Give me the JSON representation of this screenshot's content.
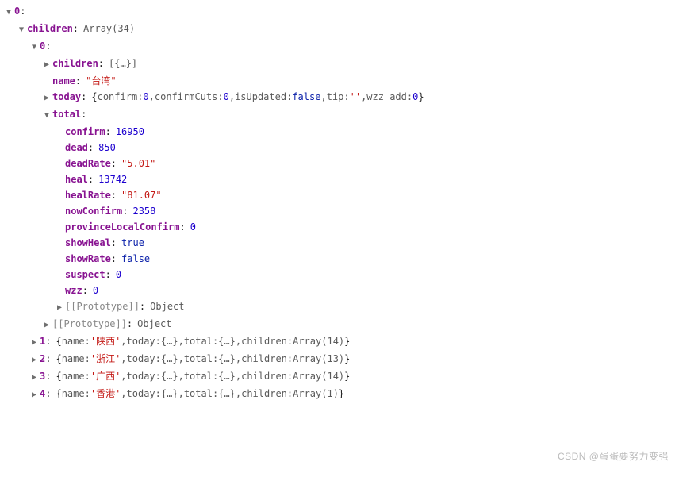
{
  "root": {
    "index": "0",
    "children_label": "children",
    "children_type": "Array(34)"
  },
  "item0": {
    "index": "0",
    "children_label": "children",
    "children_preview": "[{…}]",
    "name_label": "name",
    "name_value": "\"台湾\"",
    "today_label": "today",
    "today_preview_open": "{",
    "today_confirm_k": "confirm",
    "today_confirm_v": "0",
    "today_confirmCuts_k": "confirmCuts",
    "today_confirmCuts_v": "0",
    "today_isUpdated_k": "isUpdated",
    "today_isUpdated_v": "false",
    "today_tip_k": "tip",
    "today_tip_v": "''",
    "today_wzz_add_k": "wzz_add",
    "today_wzz_add_v": "0",
    "today_preview_close": "}",
    "total_label": "total",
    "total": {
      "confirm_k": "confirm",
      "confirm_v": "16950",
      "dead_k": "dead",
      "dead_v": "850",
      "deadRate_k": "deadRate",
      "deadRate_v": "\"5.01\"",
      "heal_k": "heal",
      "heal_v": "13742",
      "healRate_k": "healRate",
      "healRate_v": "\"81.07\"",
      "nowConfirm_k": "nowConfirm",
      "nowConfirm_v": "2358",
      "provinceLocalConfirm_k": "provinceLocalConfirm",
      "provinceLocalConfirm_v": "0",
      "showHeal_k": "showHeal",
      "showHeal_v": "true",
      "showRate_k": "showRate",
      "showRate_v": "false",
      "suspect_k": "suspect",
      "suspect_v": "0",
      "wzz_k": "wzz",
      "wzz_v": "0"
    },
    "proto_label": "[[Prototype]]",
    "proto_value": "Object"
  },
  "item0_proto_label": "[[Prototype]]",
  "item0_proto_value": "Object",
  "rows": {
    "r1": {
      "idx": "1",
      "name": "'陕西'",
      "arr": "Array(14)"
    },
    "r2": {
      "idx": "2",
      "name": "'浙江'",
      "arr": "Array(13)"
    },
    "r3": {
      "idx": "3",
      "name": "'广西'",
      "arr": "Array(14)"
    },
    "r4": {
      "idx": "4",
      "name": "'香港'",
      "arr": "Array(1)"
    }
  },
  "preview_labels": {
    "name": "name",
    "today": "today",
    "total": "total",
    "children": "children",
    "braces": "{…}"
  },
  "watermark": "CSDN @蛋蛋要努力变强"
}
